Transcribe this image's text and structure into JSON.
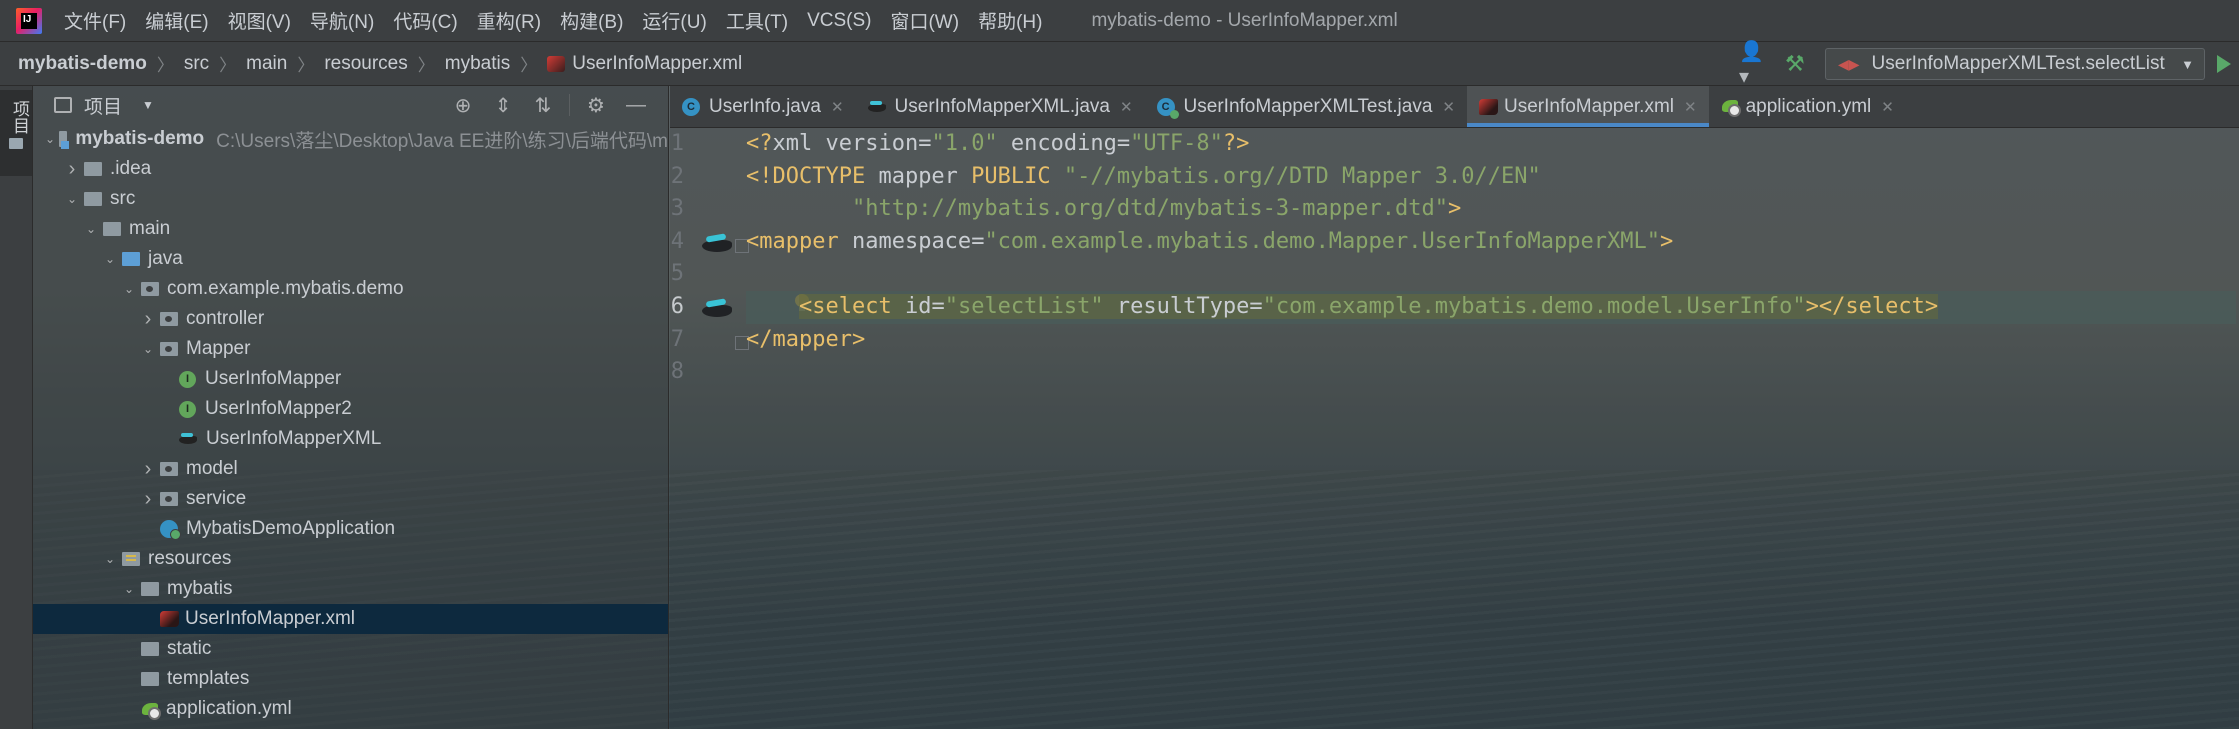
{
  "menubar": {
    "items": [
      "文件(F)",
      "编辑(E)",
      "视图(V)",
      "导航(N)",
      "代码(C)",
      "重构(R)",
      "构建(B)",
      "运行(U)",
      "工具(T)",
      "VCS(S)",
      "窗口(W)",
      "帮助(H)"
    ],
    "window_title": "mybatis-demo - UserInfoMapper.xml"
  },
  "navbar": {
    "breadcrumbs": [
      "mybatis-demo",
      "src",
      "main",
      "resources",
      "mybatis",
      "UserInfoMapper.xml"
    ],
    "run_config": "UserInfoMapperXMLTest.selectList"
  },
  "toolstrip": {
    "project_tab": "项目"
  },
  "project_panel": {
    "title": "项目",
    "tree": [
      {
        "label": "mybatis-demo",
        "path": "C:\\Users\\落尘\\Desktop\\Java EE进阶\\练习\\后端代码\\m",
        "depth": 0,
        "expanded": true,
        "icon": "module"
      },
      {
        "label": ".idea",
        "depth": 1,
        "expanded": false,
        "icon": "folder"
      },
      {
        "label": "src",
        "depth": 1,
        "expanded": true,
        "icon": "folder"
      },
      {
        "label": "main",
        "depth": 2,
        "expanded": true,
        "icon": "folder"
      },
      {
        "label": "java",
        "depth": 3,
        "expanded": true,
        "icon": "folder-blue"
      },
      {
        "label": "com.example.mybatis.demo",
        "depth": 4,
        "expanded": true,
        "icon": "package"
      },
      {
        "label": "controller",
        "depth": 5,
        "expanded": false,
        "icon": "package"
      },
      {
        "label": "Mapper",
        "depth": 5,
        "expanded": true,
        "icon": "package"
      },
      {
        "label": "UserInfoMapper",
        "depth": 6,
        "icon": "interface"
      },
      {
        "label": "UserInfoMapper2",
        "depth": 6,
        "icon": "interface"
      },
      {
        "label": "UserInfoMapperXML",
        "depth": 6,
        "icon": "mybatis"
      },
      {
        "label": "model",
        "depth": 5,
        "expanded": false,
        "icon": "package"
      },
      {
        "label": "service",
        "depth": 5,
        "expanded": false,
        "icon": "package"
      },
      {
        "label": "MybatisDemoApplication",
        "depth": 5,
        "icon": "class-run"
      },
      {
        "label": "resources",
        "depth": 3,
        "expanded": true,
        "icon": "resources"
      },
      {
        "label": "mybatis",
        "depth": 4,
        "expanded": true,
        "icon": "folder"
      },
      {
        "label": "UserInfoMapper.xml",
        "depth": 5,
        "icon": "xml",
        "selected": true
      },
      {
        "label": "static",
        "depth": 4,
        "icon": "folder"
      },
      {
        "label": "templates",
        "depth": 4,
        "icon": "folder"
      },
      {
        "label": "application.yml",
        "depth": 4,
        "icon": "yml"
      }
    ]
  },
  "editor": {
    "tabs": [
      {
        "label": "UserInfo.java",
        "icon": "class"
      },
      {
        "label": "UserInfoMapperXML.java",
        "icon": "mybatis"
      },
      {
        "label": "UserInfoMapperXMLTest.java",
        "icon": "class-test"
      },
      {
        "label": "UserInfoMapper.xml",
        "icon": "xml",
        "active": true
      },
      {
        "label": "application.yml",
        "icon": "yml"
      }
    ],
    "line_numbers": [
      "1",
      "2",
      "3",
      "4",
      "5",
      "6",
      "7",
      "8"
    ],
    "current_line": "6",
    "code": {
      "l1": {
        "a": "<?",
        "b": "xml ",
        "c": "version",
        "d": "=",
        "e": "\"1.0\"",
        "f": " encoding",
        "g": "=",
        "h": "\"UTF-8\"",
        "i": "?>"
      },
      "l2": {
        "a": "<!DOCTYPE ",
        "b": "mapper ",
        "c": "PUBLIC ",
        "d": "\"-//mybatis.org//DTD Mapper 3.0//EN\""
      },
      "l3": {
        "a": "        ",
        "b": "\"http://mybatis.org/dtd/mybatis-3-mapper.dtd\"",
        "c": ">"
      },
      "l4": {
        "a": "<mapper ",
        "b": "namespace",
        "c": "=",
        "d": "\"com.example.mybatis.demo.Mapper.UserInfoMapperXML\"",
        "e": ">"
      },
      "l6": {
        "pad": "    ",
        "a": "<select ",
        "b": "id",
        "c": "=",
        "d": "\"selectList\"",
        "e": " resultType",
        "f": "=",
        "g": "\"com.example.mybatis.demo.model.UserInfo\"",
        "h": "></select>"
      },
      "l7": {
        "a": "</mapper>"
      }
    }
  },
  "colors": {
    "tag": "#e8bf6a",
    "attribute": "#c9cdd2",
    "string": "#8aa56a",
    "selection": "#0d293e",
    "active_tab_underline": "#4a88c7"
  }
}
